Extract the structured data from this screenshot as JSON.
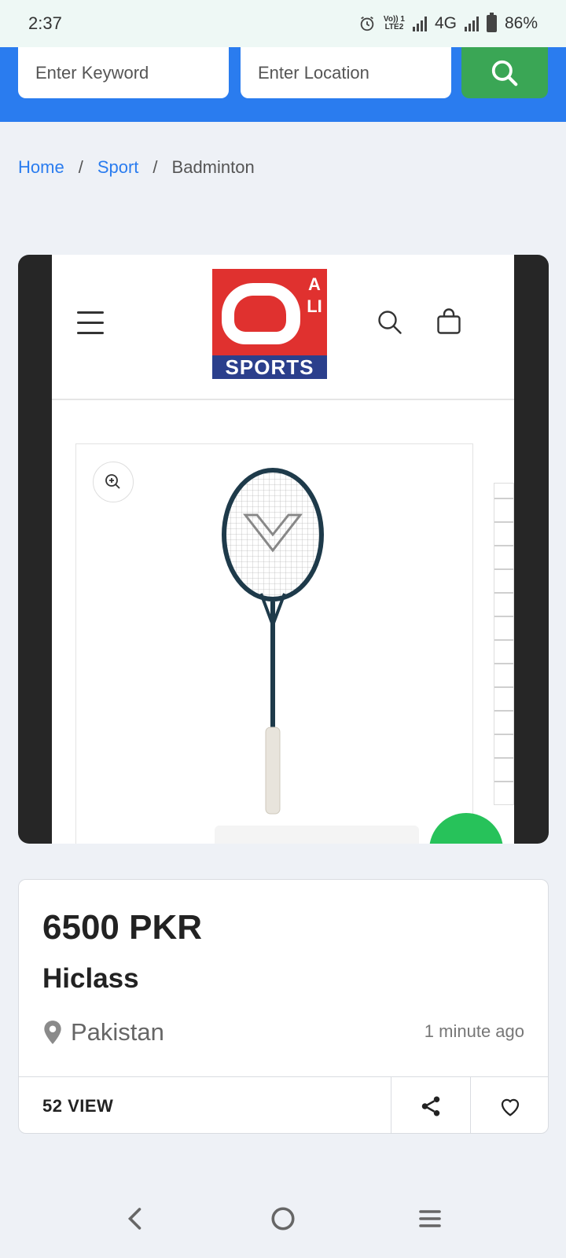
{
  "status_bar": {
    "time": "2:37",
    "volte": "Vo)) 1",
    "lte": "LTE2",
    "network": "4G",
    "battery": "86%"
  },
  "search": {
    "keyword_placeholder": "Enter Keyword",
    "location_placeholder": "Enter Location"
  },
  "breadcrumb": {
    "items": [
      "Home",
      "Sport",
      "Badminton"
    ],
    "separator": "/"
  },
  "listing_image": {
    "logo_letters": "ALI",
    "logo_text": "SPORTS"
  },
  "listing": {
    "price": "6500 PKR",
    "title": "Hiclass",
    "location": "Pakistan",
    "posted": "1 minute ago",
    "views": "52 VIEW"
  },
  "colors": {
    "brand_blue": "#2a7cef",
    "search_green": "#3aa655",
    "logo_red": "#e0312f",
    "logo_navy": "#2b3f8c",
    "whatsapp_green": "#27c25a"
  },
  "icons": {
    "search": "search-icon",
    "location": "location-pin-icon",
    "share": "share-icon",
    "favorite": "heart-icon",
    "back": "back-icon",
    "home": "home-icon",
    "menu": "menu-icon"
  }
}
